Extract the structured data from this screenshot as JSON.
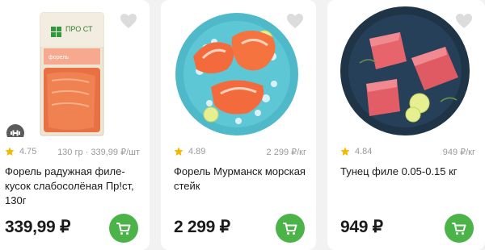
{
  "colors": {
    "accent_green": "#4bb348",
    "star_yellow": "#f5b800",
    "muted_text": "#9a9a9a"
  },
  "products": [
    {
      "rating": "4.75",
      "unit_price": "130 гр · 339,99 ₽/шт",
      "title": "Форель радужная филе-кусок слабосолёная Пр!ст, 130г",
      "price": "339,99 ₽",
      "package_brand": "ПРО СТ",
      "package_label": "форель",
      "icon": "weight-icon"
    },
    {
      "rating": "4.89",
      "unit_price": "2 299 ₽/кг",
      "title": "Форель Мурманск морская стейк",
      "price": "2 299 ₽"
    },
    {
      "rating": "4.84",
      "unit_price": "949 ₽/кг",
      "title": "Тунец филе 0.05-0.15 кг",
      "price": "949 ₽"
    }
  ]
}
